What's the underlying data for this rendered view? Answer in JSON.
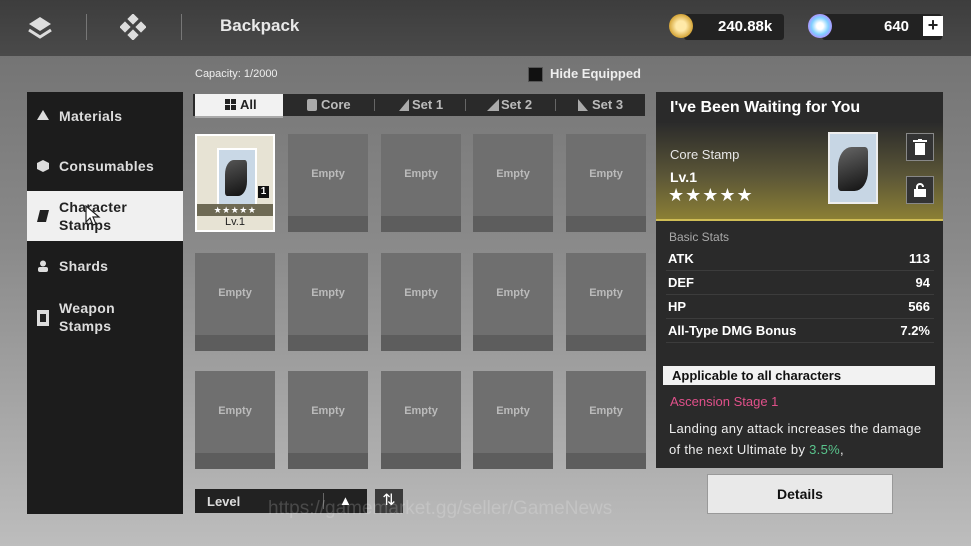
{
  "header": {
    "title": "Backpack",
    "gold_value": "240.88k",
    "gem_value": "640",
    "plus_label": "+"
  },
  "sidebar": {
    "items": [
      {
        "label": "Materials",
        "icon": "materials-icon"
      },
      {
        "label": "Consumables",
        "icon": "consumables-icon"
      },
      {
        "label_line1": "Character",
        "label_line2": "Stamps",
        "icon": "stamp-icon",
        "active": true
      },
      {
        "label": "Shards",
        "icon": "shards-icon"
      },
      {
        "label_line1": "Weapon",
        "label_line2": "Stamps",
        "icon": "weapon-stamp-icon"
      }
    ]
  },
  "inventory": {
    "capacity": "Capacity: 1/2000",
    "hide_equipped": "Hide Equipped",
    "tabs": [
      "All",
      "Core",
      "Set 1",
      "Set 2",
      "Set 3"
    ],
    "empty_label": "Empty",
    "filled_slot": {
      "count": "1",
      "stars": "★★★★★",
      "level": "Lv.1"
    },
    "sort_label": "Level",
    "sort_arrow": "▲",
    "sort_toggle": "⇅"
  },
  "detail": {
    "title": "I've Been Waiting for You",
    "type": "Core Stamp",
    "level": "Lv.1",
    "stars": "★★★★★",
    "basic_stats_label": "Basic Stats",
    "stats": [
      {
        "name": "ATK",
        "value": "113"
      },
      {
        "name": "DEF",
        "value": "94"
      },
      {
        "name": "HP",
        "value": "566"
      },
      {
        "name": "All-Type DMG Bonus",
        "value": "7.2%"
      }
    ],
    "applicable": "Applicable to all characters",
    "ascension": "Ascension Stage 1",
    "desc_part1": "Landing any attack increases the damage of the next Ultimate by ",
    "desc_highlight": "3.5%",
    "desc_part2": ","
  },
  "details_button": "Details",
  "watermark": "https://gamemarket.gg/seller/GameNews",
  "colors": {
    "accent_gold": "#cfbd55",
    "ascension_pink": "#e0508a",
    "highlight_green": "#59c48c"
  }
}
